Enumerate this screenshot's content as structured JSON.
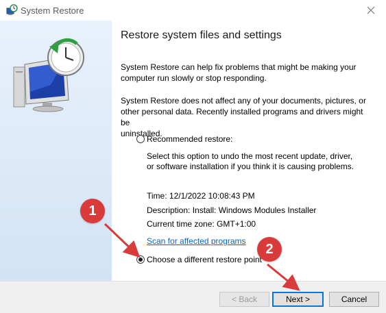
{
  "window": {
    "title": "System Restore"
  },
  "header": {
    "title": "Restore system files and settings"
  },
  "intro": {
    "p1_line1": "System Restore can help fix problems that might be making your",
    "p1_line2": "computer run slowly or stop responding.",
    "p2_line1": "System Restore does not affect any of your documents, pictures, or",
    "p2_line2": "other personal data. Recently installed programs and drivers might be",
    "p2_line3": "uninstalled."
  },
  "recommended": {
    "label": "Recommended restore:",
    "selected": false,
    "desc_line1": "Select this option to undo the most recent update, driver,",
    "desc_line2": "or software installation if you think it is causing problems.",
    "time": "Time: 12/1/2022 10:08:43 PM",
    "description": "Description: Install: Windows Modules Installer",
    "timezone": "Current time zone: GMT+1:00",
    "scan_link": "Scan for affected programs"
  },
  "different": {
    "label": "Choose a different restore point",
    "selected": true
  },
  "buttons": {
    "back": "< Back",
    "next": "Next >",
    "cancel": "Cancel"
  },
  "annotations": {
    "badge1": "1",
    "badge2": "2"
  },
  "colors": {
    "badge": "#d93a3a",
    "link": "#0066cc",
    "panel": "#dce8f6"
  }
}
